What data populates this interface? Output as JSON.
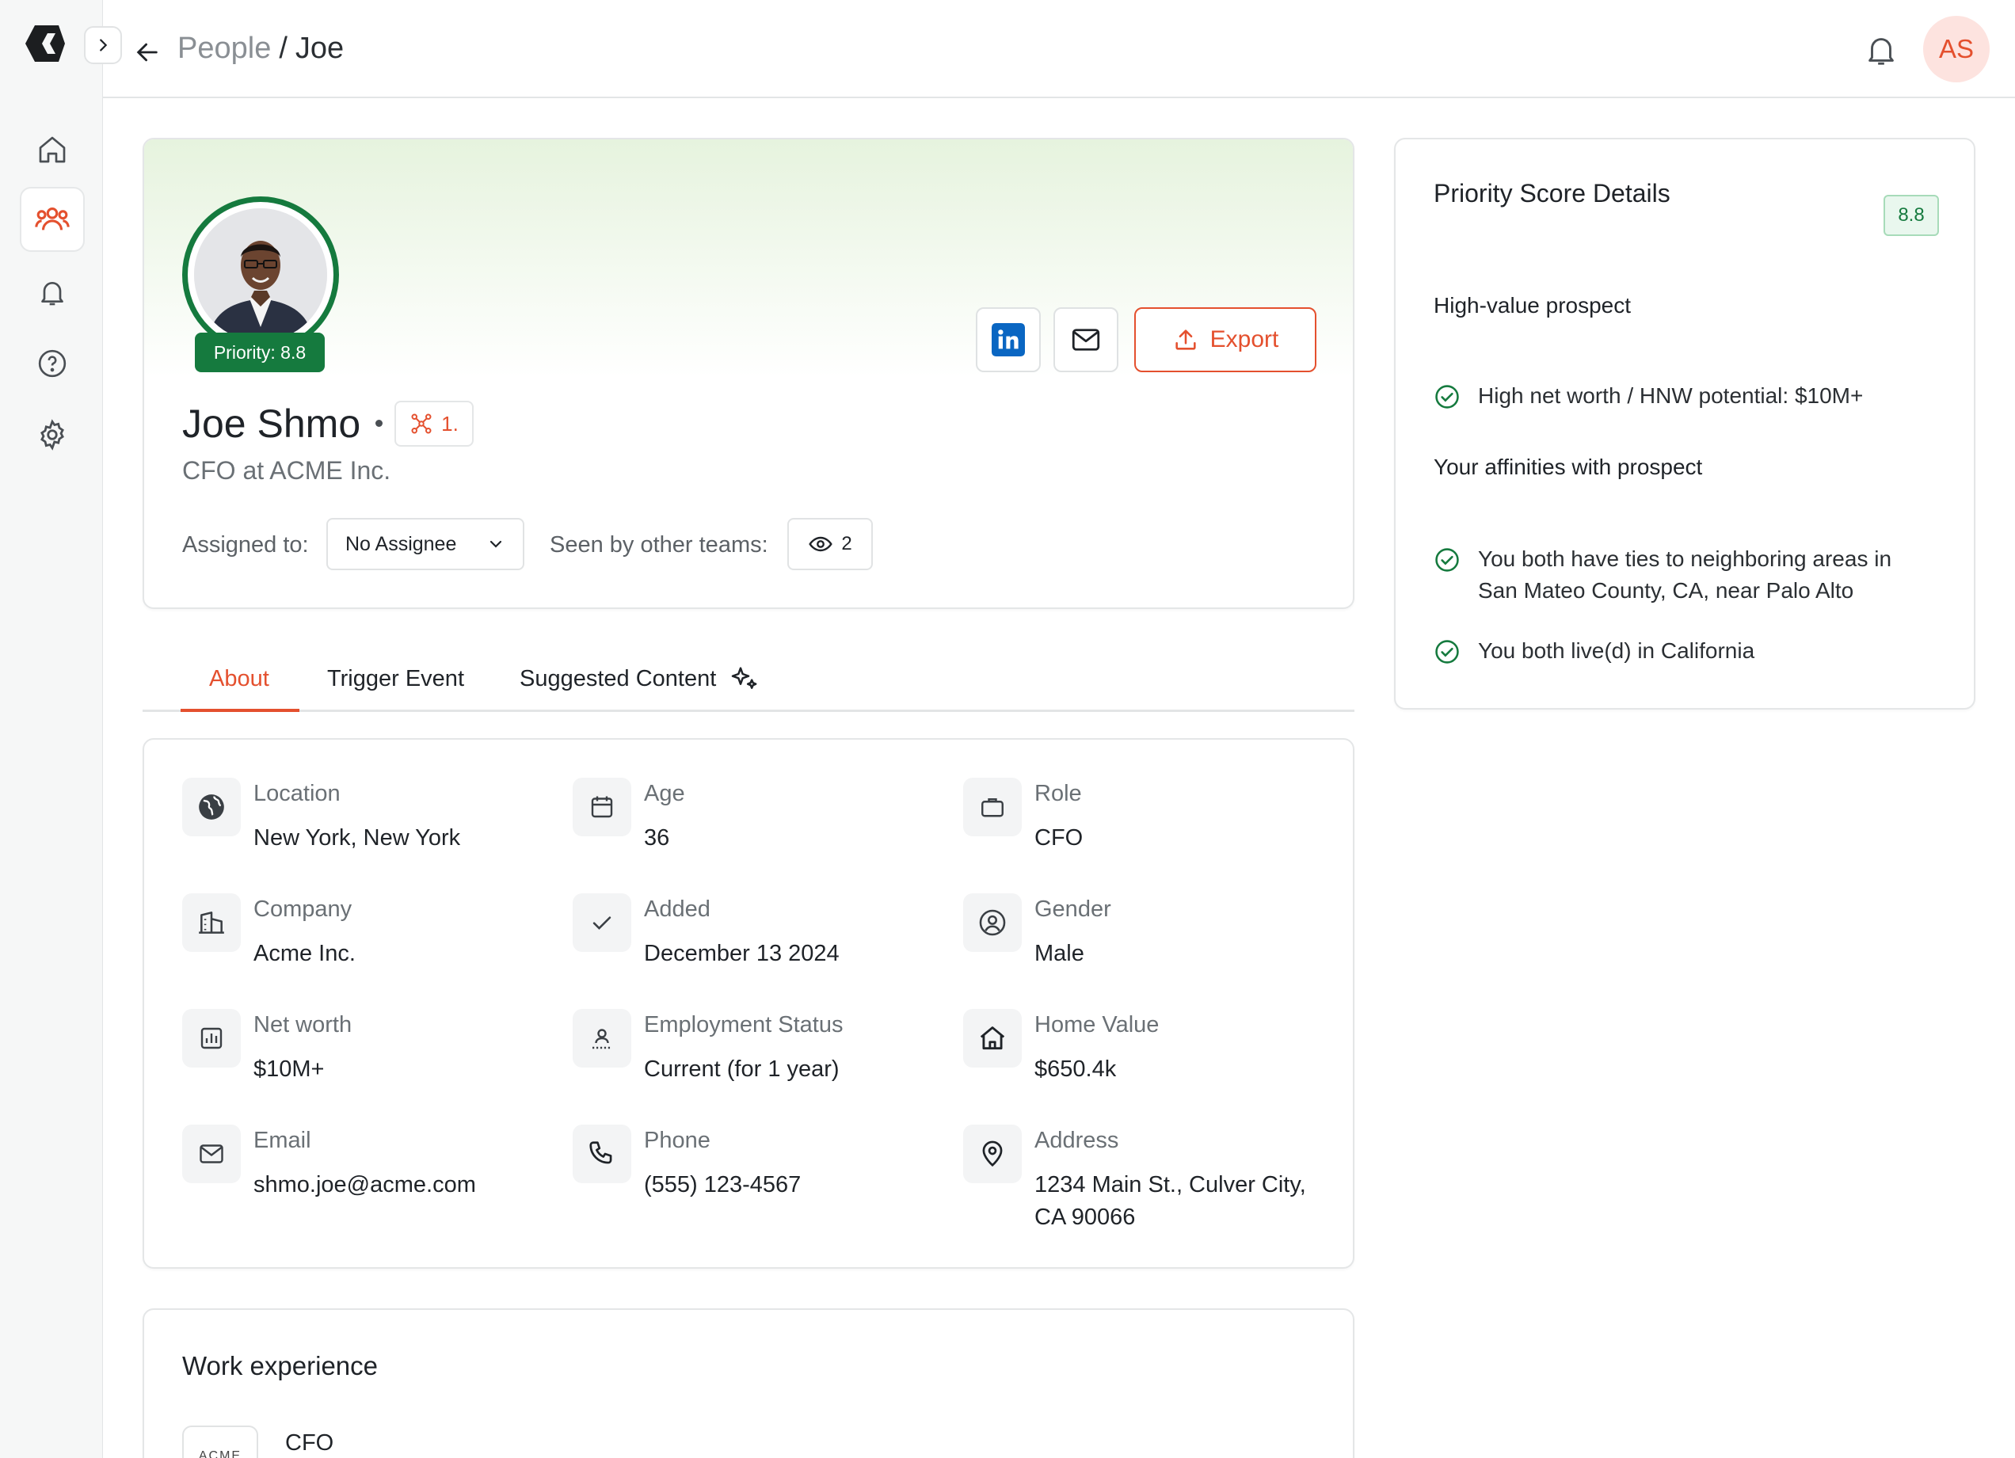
{
  "breadcrumb": {
    "parent": "People",
    "separator": "/",
    "current": "Joe"
  },
  "user": {
    "initials": "AS"
  },
  "profile": {
    "priority_label": "Priority: 8.8",
    "name": "Joe Shmo",
    "connection_badge": "1.",
    "title": "CFO at ACME Inc.",
    "assigned_label": "Assigned to:",
    "assignee": "No Assignee",
    "seen_label": "Seen by other teams:",
    "seen_count": "2",
    "export_label": "Export"
  },
  "tabs": [
    {
      "label": "About"
    },
    {
      "label": "Trigger Event"
    },
    {
      "label": "Suggested Content"
    }
  ],
  "about": [
    {
      "label": "Location",
      "value": "New York, New York",
      "icon": "globe-icon"
    },
    {
      "label": "Age",
      "value": "36",
      "icon": "calendar-icon"
    },
    {
      "label": "Role",
      "value": "CFO",
      "icon": "briefcase-icon"
    },
    {
      "label": "Company",
      "value": "Acme Inc.",
      "icon": "building-icon"
    },
    {
      "label": "Added",
      "value": "December 13 2024",
      "icon": "check-icon"
    },
    {
      "label": "Gender",
      "value": "Male",
      "icon": "person-circle-icon"
    },
    {
      "label": "Net worth",
      "value": "$10M+",
      "icon": "bar-chart-icon"
    },
    {
      "label": "Employment Status",
      "value": "Current (for 1 year)",
      "icon": "employee-icon"
    },
    {
      "label": "Home Value",
      "value": "$650.4k",
      "icon": "house-icon"
    },
    {
      "label": "Email",
      "value": "shmo.joe@acme.com",
      "icon": "mail-icon"
    },
    {
      "label": "Phone",
      "value": "(555) 123-4567",
      "icon": "phone-icon"
    },
    {
      "label": "Address",
      "value_line1": "1234 Main St., Culver City,",
      "value_line2": "CA 90066",
      "icon": "map-pin-icon"
    }
  ],
  "work": {
    "title": "Work experience",
    "logo_text": "ACME",
    "role": "CFO"
  },
  "score": {
    "title": "Priority Score Details",
    "value": "8.8",
    "section1": "High-value prospect",
    "items1": [
      "High net worth / HNW potential: $10M+"
    ],
    "section2": "Your affinities with prospect",
    "items2": [
      "You both have ties to neighboring areas in San Mateo County, CA, near Palo Alto",
      "You both live(d) in California"
    ]
  },
  "colors": {
    "accent": "#e4502e",
    "brand_green": "#157a3e",
    "linkedin": "#0a66c2"
  }
}
